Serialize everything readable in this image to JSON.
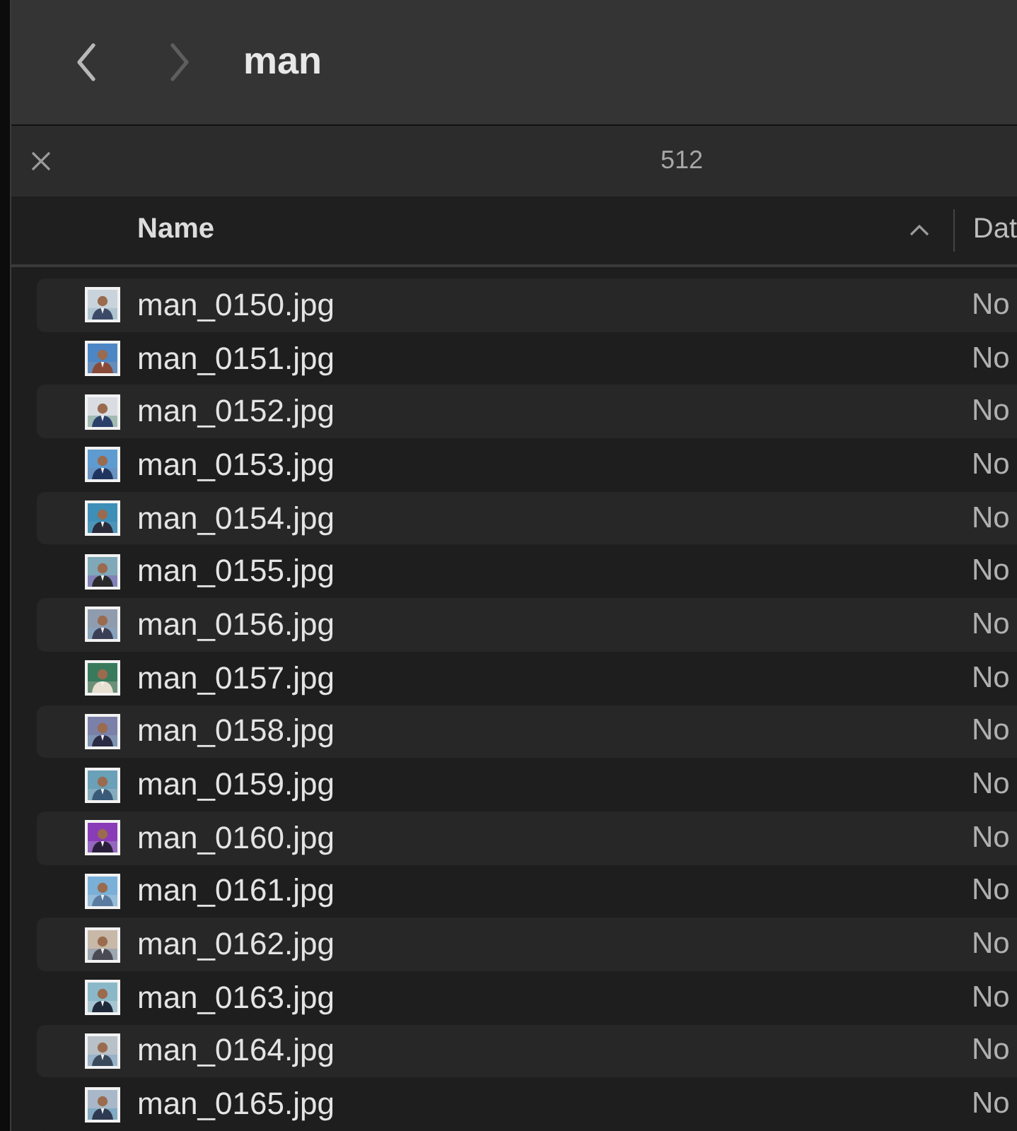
{
  "toolbar": {
    "title": "man"
  },
  "filter_bar": {
    "count": "512"
  },
  "columns": [
    {
      "label": "Name",
      "sorted": true
    },
    {
      "label": "Dat",
      "sorted": false
    }
  ],
  "files": [
    {
      "name": "man_0150.jpg",
      "date": "No"
    },
    {
      "name": "man_0151.jpg",
      "date": "No"
    },
    {
      "name": "man_0152.jpg",
      "date": "No"
    },
    {
      "name": "man_0153.jpg",
      "date": "No"
    },
    {
      "name": "man_0154.jpg",
      "date": "No"
    },
    {
      "name": "man_0155.jpg",
      "date": "No"
    },
    {
      "name": "man_0156.jpg",
      "date": "No"
    },
    {
      "name": "man_0157.jpg",
      "date": "No"
    },
    {
      "name": "man_0158.jpg",
      "date": "No"
    },
    {
      "name": "man_0159.jpg",
      "date": "No"
    },
    {
      "name": "man_0160.jpg",
      "date": "No"
    },
    {
      "name": "man_0161.jpg",
      "date": "No"
    },
    {
      "name": "man_0162.jpg",
      "date": "No"
    },
    {
      "name": "man_0163.jpg",
      "date": "No"
    },
    {
      "name": "man_0164.jpg",
      "date": "No"
    },
    {
      "name": "man_0165.jpg",
      "date": "No"
    }
  ]
}
